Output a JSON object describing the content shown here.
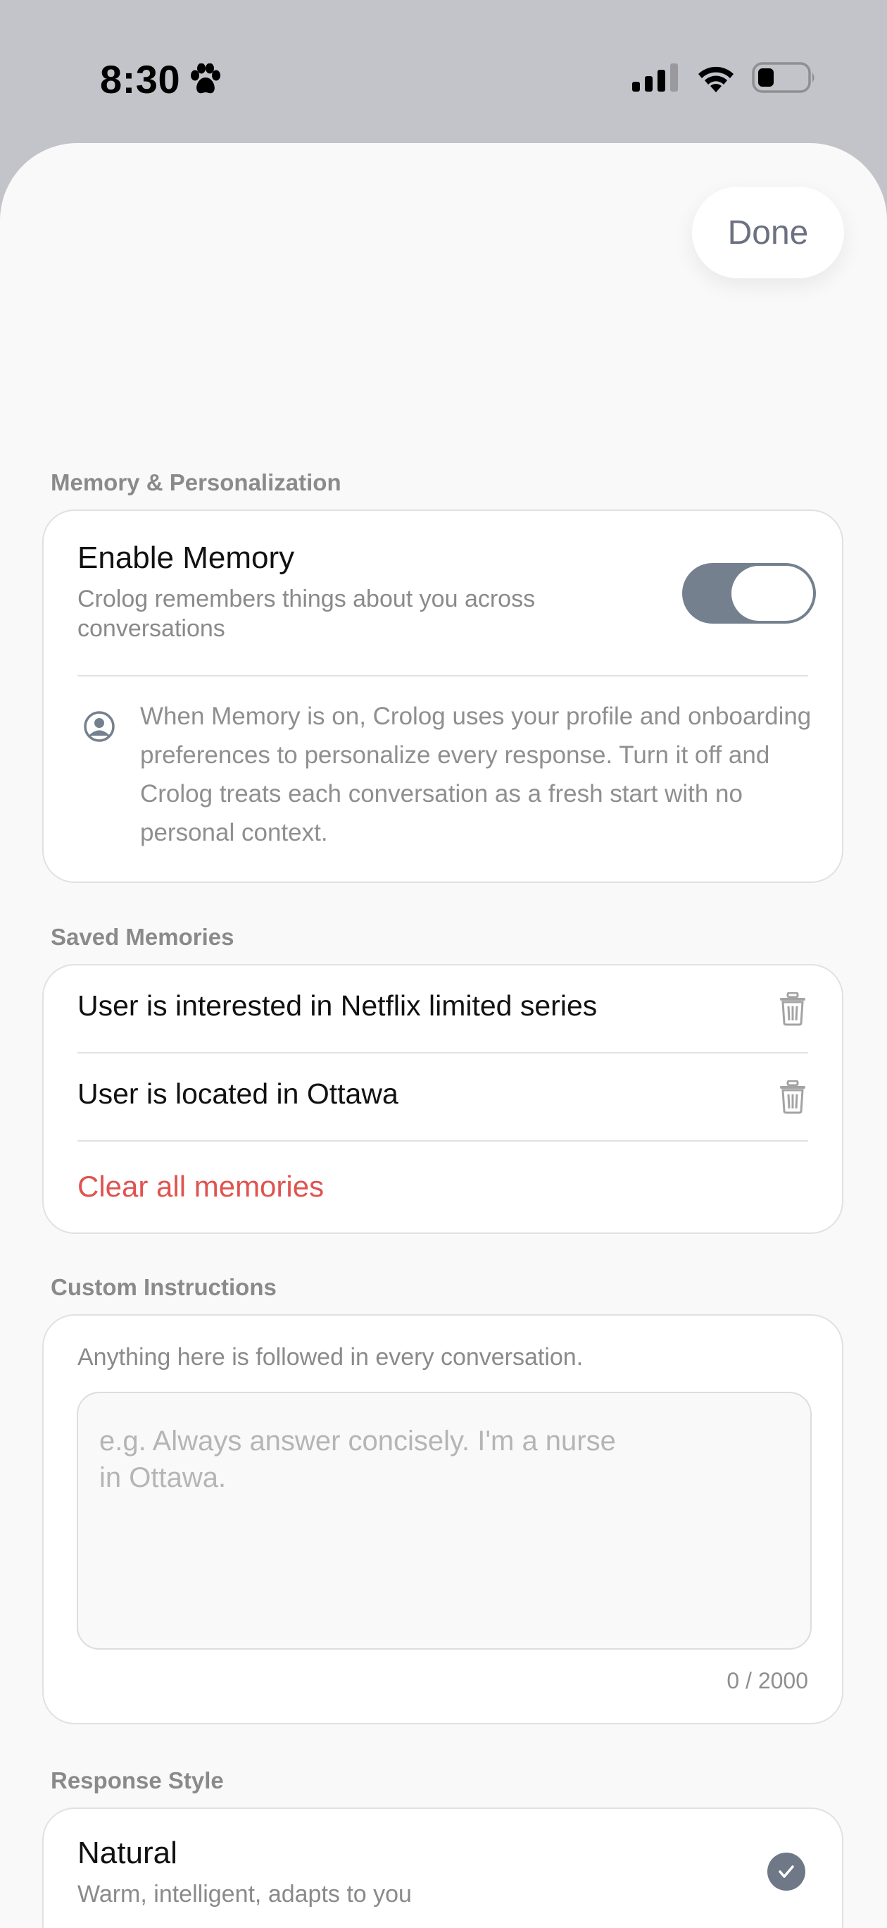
{
  "status_bar": {
    "time": "8:30"
  },
  "header": {
    "done_label": "Done"
  },
  "memory_section": {
    "label": "Memory & Personalization",
    "enable_title": "Enable Memory",
    "enable_subtitle": "Crolog remembers things about you across conversations",
    "enabled": true,
    "info_text": "When Memory is on, Crolog uses your profile and onboarding preferences to personalize every response. Turn it off and Crolog treats each conversation as a fresh start with no personal context."
  },
  "saved_memories": {
    "label": "Saved Memories",
    "items": [
      {
        "text": "User is interested in Netflix limited series"
      },
      {
        "text": "User is located in Ottawa"
      }
    ],
    "clear_all_label": "Clear all memories"
  },
  "custom_instructions": {
    "label": "Custom Instructions",
    "hint": "Anything here is followed in every conversation.",
    "value": "",
    "placeholder": "e.g. Always answer concisely. I'm a nurse\nin Ottawa.",
    "counter": "0 / 2000"
  },
  "response_style": {
    "label": "Response Style",
    "selected": {
      "title": "Natural",
      "subtitle": "Warm, intelligent, adapts to you"
    }
  },
  "colors": {
    "accent_gray": "#75808f",
    "danger": "#e0534f",
    "sheet_bg": "#f9f9f9",
    "card_bg": "#ffffff"
  }
}
